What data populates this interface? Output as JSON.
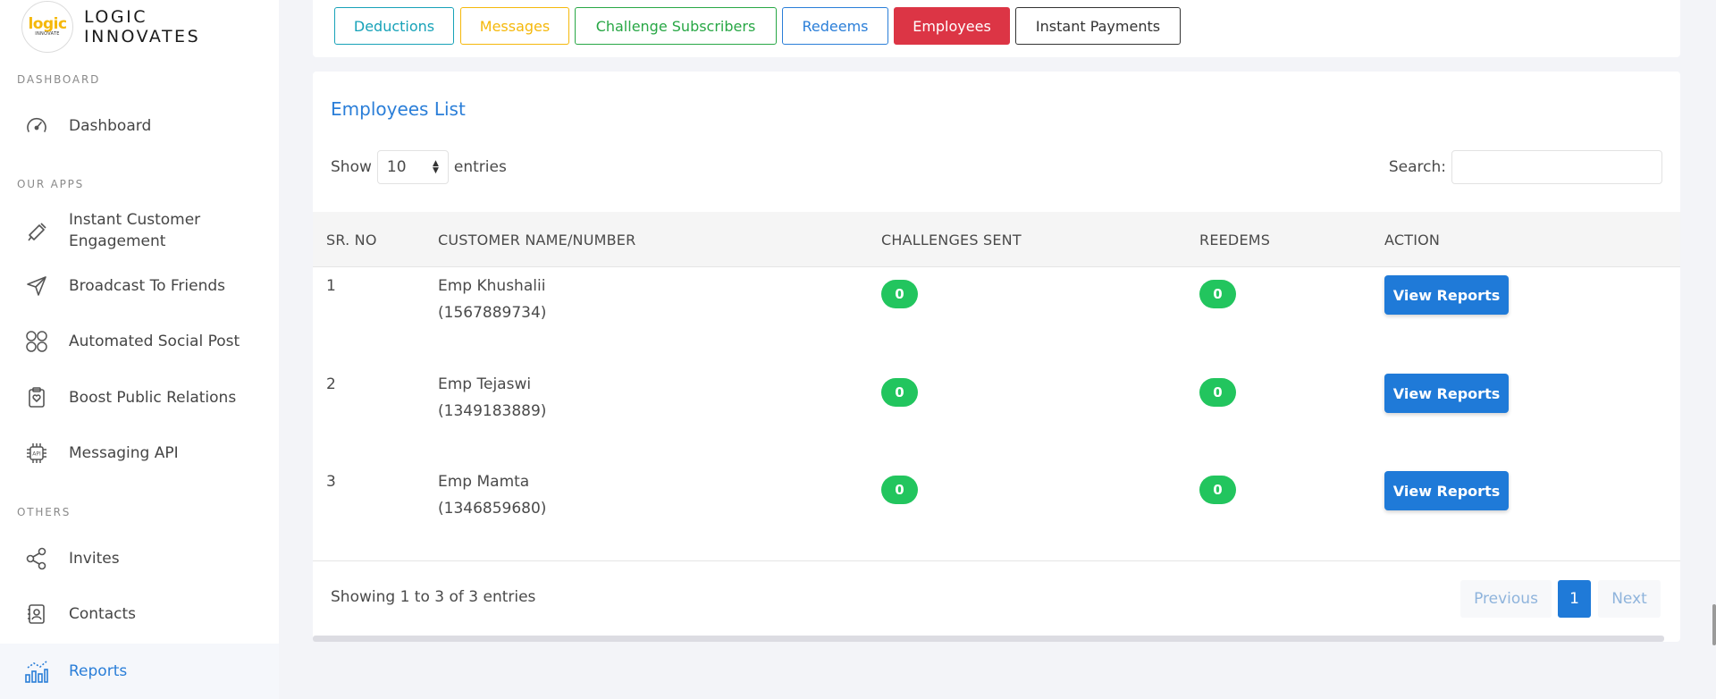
{
  "brand": {
    "logo_text": "logic",
    "logo_subtext": "INNOVATE",
    "name_line1": "LOGIC",
    "name_line2": "INNOVATES"
  },
  "sidebar": {
    "sections": [
      "DASHBOARD",
      "OUR APPS",
      "OTHERS"
    ],
    "items": [
      {
        "label": "Dashboard",
        "icon": "speedometer-icon"
      },
      {
        "label": "Instant Customer Engagement",
        "icon": "megaphone-icon"
      },
      {
        "label": "Broadcast To Friends",
        "icon": "paper-plane-icon"
      },
      {
        "label": "Automated Social Post",
        "icon": "social-grid-icon"
      },
      {
        "label": "Boost Public Relations",
        "icon": "clipboard-heart-icon"
      },
      {
        "label": "Messaging API",
        "icon": "api-chip-icon"
      },
      {
        "label": "Invites",
        "icon": "share-nodes-icon"
      },
      {
        "label": "Contacts",
        "icon": "contact-book-icon"
      },
      {
        "label": "Reports",
        "icon": "bar-chart-icon",
        "active": true
      }
    ]
  },
  "tabs": [
    {
      "label": "Deductions",
      "color": "#17a2b8"
    },
    {
      "label": "Messages",
      "color": "#f5b80b"
    },
    {
      "label": "Challenge Subscribers",
      "color": "#28a745"
    },
    {
      "label": "Redeems",
      "color": "#2a7ed8"
    },
    {
      "label": "Employees",
      "color": "#dc3545",
      "active": true
    },
    {
      "label": "Instant Payments",
      "color": "#333333"
    }
  ],
  "card": {
    "title": "Employees List",
    "show_label": "Show",
    "entries_value": "10",
    "entries_label": "entries",
    "search_label": "Search:",
    "search_value": ""
  },
  "table": {
    "columns": [
      "SR. NO",
      "CUSTOMER NAME/NUMBER",
      "CHALLENGES SENT",
      "REEDEMS",
      "ACTION"
    ],
    "rows": [
      {
        "sr": "1",
        "name": "Emp Khushalii",
        "number": "(1567889734)",
        "challenges": "0",
        "redeems": "0",
        "action": "View Reports"
      },
      {
        "sr": "2",
        "name": "Emp Tejaswi",
        "number": "(1349183889)",
        "challenges": "0",
        "redeems": "0",
        "action": "View Reports"
      },
      {
        "sr": "3",
        "name": "Emp Mamta",
        "number": "(1346859680)",
        "challenges": "0",
        "redeems": "0",
        "action": "View Reports"
      }
    ]
  },
  "footer": {
    "info": "Showing 1 to 3 of 3 entries",
    "previous": "Previous",
    "page": "1",
    "next": "Next"
  },
  "colors": {
    "accent": "#2a7ed8",
    "success": "#22c55e",
    "danger": "#dc3545"
  }
}
